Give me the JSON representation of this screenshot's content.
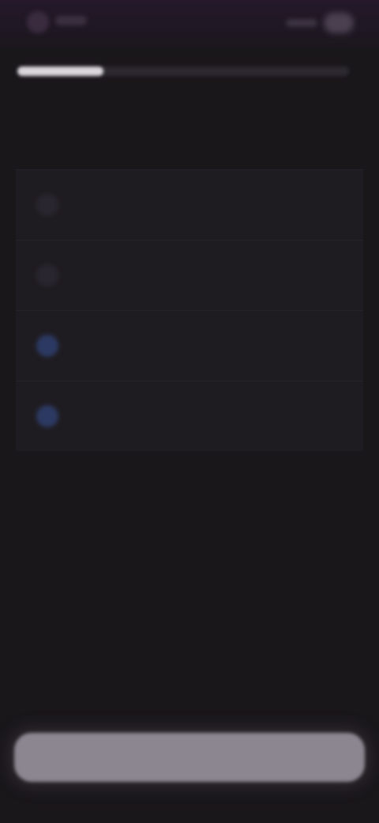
{
  "progress": {
    "fraction": 0.26
  },
  "question": {
    "text": ""
  },
  "options": [
    {
      "label": "",
      "selected": false,
      "icon_color": "#2a2630"
    },
    {
      "label": "",
      "selected": false,
      "icon_color": "#2a2630"
    },
    {
      "label": "",
      "selected": false,
      "icon_color": "#2c3a63"
    },
    {
      "label": "",
      "selected": false,
      "icon_color": "#2c3a63"
    }
  ],
  "cta": {
    "label": ""
  }
}
